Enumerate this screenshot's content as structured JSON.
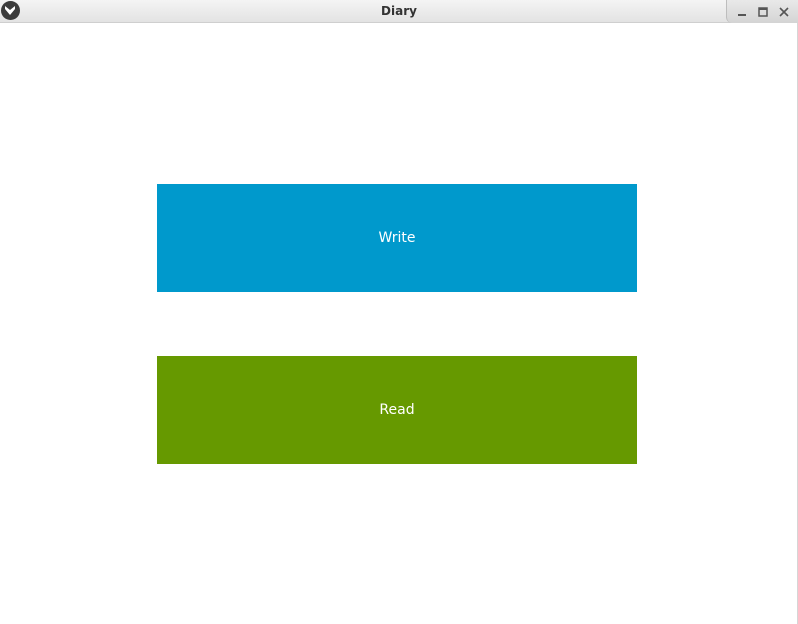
{
  "window": {
    "title": "Diary"
  },
  "buttons": {
    "write_label": "Write",
    "read_label": "Read"
  },
  "colors": {
    "write": "#0099cc",
    "read": "#669900",
    "background": "#ffffff"
  },
  "icons": {
    "app": "kivy-logo-icon",
    "minimize": "minimize-icon",
    "maximize": "maximize-icon",
    "close": "close-icon"
  }
}
